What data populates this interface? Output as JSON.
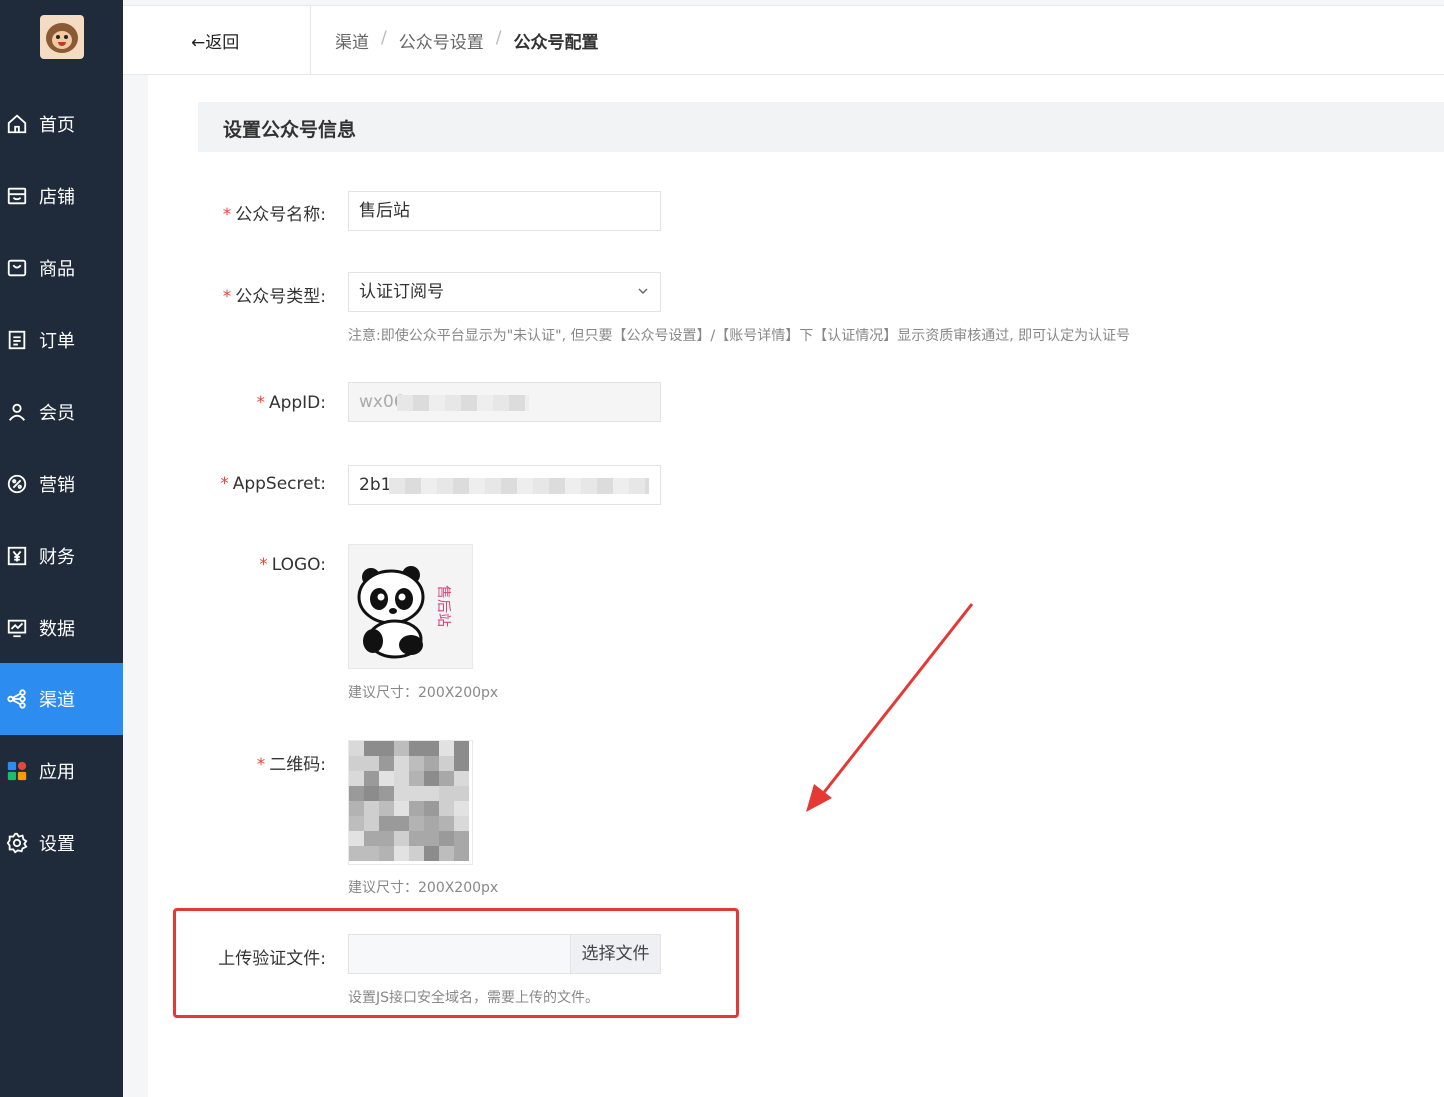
{
  "sidebar": {
    "items": [
      {
        "label": "首页",
        "icon": "home-icon"
      },
      {
        "label": "店铺",
        "icon": "shop-icon"
      },
      {
        "label": "商品",
        "icon": "bag-icon"
      },
      {
        "label": "订单",
        "icon": "order-icon"
      },
      {
        "label": "会员",
        "icon": "user-icon"
      },
      {
        "label": "营销",
        "icon": "percent-icon"
      },
      {
        "label": "财务",
        "icon": "yuan-icon"
      },
      {
        "label": "数据",
        "icon": "chart-icon"
      },
      {
        "label": "渠道",
        "icon": "share-icon"
      },
      {
        "label": "应用",
        "icon": "apps-icon"
      },
      {
        "label": "设置",
        "icon": "gear-icon"
      }
    ],
    "active": "渠道"
  },
  "header": {
    "back_label": "←返回",
    "breadcrumb": [
      "渠道",
      "公众号设置",
      "公众号配置"
    ],
    "separator": "/"
  },
  "section": {
    "title": "设置公众号信息"
  },
  "form": {
    "name": {
      "label": "公众号名称:",
      "value": "售后站"
    },
    "type": {
      "label": "公众号类型:",
      "value": "认证订阅号",
      "hint": "注意:即使公众平台显示为\"未认证\", 但只要【公众号设置】/【账号详情】下【认证情况】显示资质审核通过, 即可认定为认证号"
    },
    "appid": {
      "label": "AppID:",
      "value": "wx06"
    },
    "appsecret": {
      "label": "AppSecret:",
      "value": "2b1"
    },
    "logo": {
      "label": "LOGO:",
      "hint": "建议尺寸：200X200px",
      "image_text": "售后站"
    },
    "qrcode": {
      "label": "二维码:",
      "hint": "建议尺寸：200X200px"
    },
    "upload": {
      "label": "上传验证文件:",
      "button": "选择文件",
      "hint": "设置JS接口安全域名，需要上传的文件。"
    }
  },
  "colors": {
    "sidebar_bg": "#1f2b3a",
    "active_bg": "#2d8cf0",
    "required": "#e5483b",
    "highlight": "#e53935"
  }
}
